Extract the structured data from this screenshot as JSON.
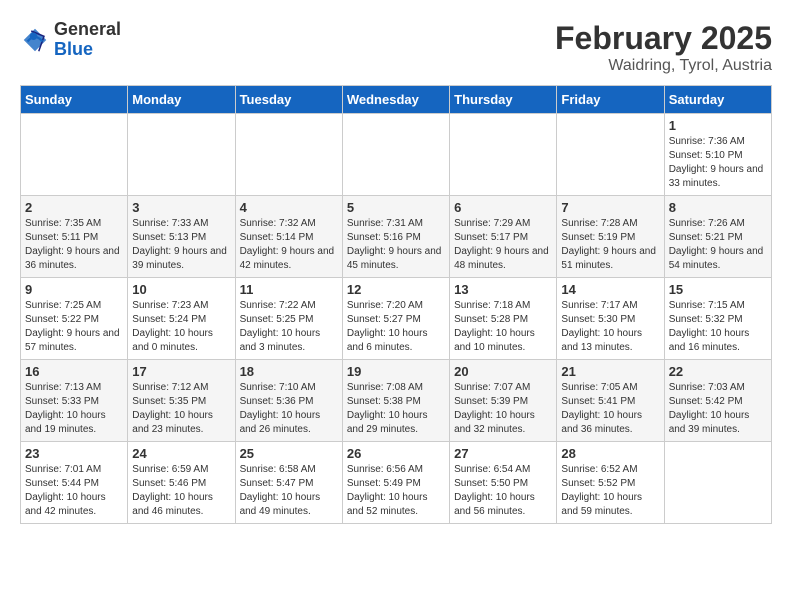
{
  "header": {
    "logo_general": "General",
    "logo_blue": "Blue",
    "title": "February 2025",
    "subtitle": "Waidring, Tyrol, Austria"
  },
  "weekdays": [
    "Sunday",
    "Monday",
    "Tuesday",
    "Wednesday",
    "Thursday",
    "Friday",
    "Saturday"
  ],
  "weeks": [
    [
      {
        "day": "",
        "info": ""
      },
      {
        "day": "",
        "info": ""
      },
      {
        "day": "",
        "info": ""
      },
      {
        "day": "",
        "info": ""
      },
      {
        "day": "",
        "info": ""
      },
      {
        "day": "",
        "info": ""
      },
      {
        "day": "1",
        "info": "Sunrise: 7:36 AM\nSunset: 5:10 PM\nDaylight: 9 hours and 33 minutes."
      }
    ],
    [
      {
        "day": "2",
        "info": "Sunrise: 7:35 AM\nSunset: 5:11 PM\nDaylight: 9 hours and 36 minutes."
      },
      {
        "day": "3",
        "info": "Sunrise: 7:33 AM\nSunset: 5:13 PM\nDaylight: 9 hours and 39 minutes."
      },
      {
        "day": "4",
        "info": "Sunrise: 7:32 AM\nSunset: 5:14 PM\nDaylight: 9 hours and 42 minutes."
      },
      {
        "day": "5",
        "info": "Sunrise: 7:31 AM\nSunset: 5:16 PM\nDaylight: 9 hours and 45 minutes."
      },
      {
        "day": "6",
        "info": "Sunrise: 7:29 AM\nSunset: 5:17 PM\nDaylight: 9 hours and 48 minutes."
      },
      {
        "day": "7",
        "info": "Sunrise: 7:28 AM\nSunset: 5:19 PM\nDaylight: 9 hours and 51 minutes."
      },
      {
        "day": "8",
        "info": "Sunrise: 7:26 AM\nSunset: 5:21 PM\nDaylight: 9 hours and 54 minutes."
      }
    ],
    [
      {
        "day": "9",
        "info": "Sunrise: 7:25 AM\nSunset: 5:22 PM\nDaylight: 9 hours and 57 minutes."
      },
      {
        "day": "10",
        "info": "Sunrise: 7:23 AM\nSunset: 5:24 PM\nDaylight: 10 hours and 0 minutes."
      },
      {
        "day": "11",
        "info": "Sunrise: 7:22 AM\nSunset: 5:25 PM\nDaylight: 10 hours and 3 minutes."
      },
      {
        "day": "12",
        "info": "Sunrise: 7:20 AM\nSunset: 5:27 PM\nDaylight: 10 hours and 6 minutes."
      },
      {
        "day": "13",
        "info": "Sunrise: 7:18 AM\nSunset: 5:28 PM\nDaylight: 10 hours and 10 minutes."
      },
      {
        "day": "14",
        "info": "Sunrise: 7:17 AM\nSunset: 5:30 PM\nDaylight: 10 hours and 13 minutes."
      },
      {
        "day": "15",
        "info": "Sunrise: 7:15 AM\nSunset: 5:32 PM\nDaylight: 10 hours and 16 minutes."
      }
    ],
    [
      {
        "day": "16",
        "info": "Sunrise: 7:13 AM\nSunset: 5:33 PM\nDaylight: 10 hours and 19 minutes."
      },
      {
        "day": "17",
        "info": "Sunrise: 7:12 AM\nSunset: 5:35 PM\nDaylight: 10 hours and 23 minutes."
      },
      {
        "day": "18",
        "info": "Sunrise: 7:10 AM\nSunset: 5:36 PM\nDaylight: 10 hours and 26 minutes."
      },
      {
        "day": "19",
        "info": "Sunrise: 7:08 AM\nSunset: 5:38 PM\nDaylight: 10 hours and 29 minutes."
      },
      {
        "day": "20",
        "info": "Sunrise: 7:07 AM\nSunset: 5:39 PM\nDaylight: 10 hours and 32 minutes."
      },
      {
        "day": "21",
        "info": "Sunrise: 7:05 AM\nSunset: 5:41 PM\nDaylight: 10 hours and 36 minutes."
      },
      {
        "day": "22",
        "info": "Sunrise: 7:03 AM\nSunset: 5:42 PM\nDaylight: 10 hours and 39 minutes."
      }
    ],
    [
      {
        "day": "23",
        "info": "Sunrise: 7:01 AM\nSunset: 5:44 PM\nDaylight: 10 hours and 42 minutes."
      },
      {
        "day": "24",
        "info": "Sunrise: 6:59 AM\nSunset: 5:46 PM\nDaylight: 10 hours and 46 minutes."
      },
      {
        "day": "25",
        "info": "Sunrise: 6:58 AM\nSunset: 5:47 PM\nDaylight: 10 hours and 49 minutes."
      },
      {
        "day": "26",
        "info": "Sunrise: 6:56 AM\nSunset: 5:49 PM\nDaylight: 10 hours and 52 minutes."
      },
      {
        "day": "27",
        "info": "Sunrise: 6:54 AM\nSunset: 5:50 PM\nDaylight: 10 hours and 56 minutes."
      },
      {
        "day": "28",
        "info": "Sunrise: 6:52 AM\nSunset: 5:52 PM\nDaylight: 10 hours and 59 minutes."
      },
      {
        "day": "",
        "info": ""
      }
    ]
  ]
}
